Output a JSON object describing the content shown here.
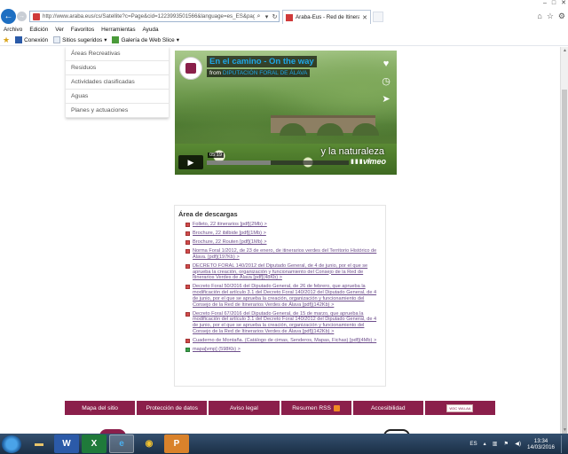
{
  "browser": {
    "address_host": "araba.eus",
    "address_url": "http://www.araba.eus/cs/Satellite?c=Page&cid=1223993501566&language=es_ES&pagename",
    "tab_label": "Araba-Eus - Red de Itinerari...",
    "menu": [
      "Archivo",
      "Edición",
      "Ver",
      "Favoritos",
      "Herramientas",
      "Ayuda"
    ],
    "favorites": [
      {
        "label": "Conexión"
      },
      {
        "label": "Sitios sugeridos"
      },
      {
        "label": "Galería de Web Slice"
      }
    ]
  },
  "sidemenu": {
    "items": [
      "Áreas Recreativas",
      "Residuos",
      "Actividades clasificadas",
      "Aguas",
      "Planes y actuaciones"
    ]
  },
  "video": {
    "title": "En el camino - On the way",
    "from_prefix": "from",
    "from_name": "DIPUTACIÓN FORAL DE ÁLAVA",
    "time": "05:19",
    "caption": "y la naturaleza",
    "brand": "vimeo",
    "progress_loaded": 0.45
  },
  "downloads": {
    "title": "Área de descargas",
    "items": [
      {
        "text": "Folleto, 22 itinerarios [pdf](2Mb) >",
        "type": "pdf"
      },
      {
        "text": "Brochure, 22 ibilbide [pdf](1Mb) >",
        "type": "pdf"
      },
      {
        "text": "Brochure, 22 Routen [pdf](1Mb) >",
        "type": "pdf"
      },
      {
        "text": "Norma Foral 1/2012, de 23 de enero, de itinerarios verdes del Territorio Histórico de Álava. [pdf](197Kb) >",
        "type": "pdf"
      },
      {
        "text": "DECRETO FORAL 140/2012 del Diputado General, de 4 de junio, por el que se aprueba la creación, organización y funcionamiento del Consejo de la Red de Itinerarios Verdes de Álava [pdf](48Kb) >",
        "type": "pdf"
      },
      {
        "text": "Decreto Foral 50/2016 del Diputado General, de 26 de febrero, que aprueba la modificación del artículo 3.1 del Decreto Foral 140/2012 del Diputado General, de 4 de junio, por el que se aprueba la creación, organización y funcionamiento del Consejo de la Red de Itinerarios Verdes de Álava [pdf](142Kb) >",
        "type": "pdf"
      },
      {
        "text": "Decreto Foral 67/2016 del Diputado General, de 15 de marzo, que aprueba la modificación del artículo 3.1 del Decreto Foral 140/2012 del Diputado General, de 4 de junio, por el que se aprueba la creación, organización y funcionamiento del Consejo de la Red de Itinerarios Verdes de Álava [pdf](142Kb) >",
        "type": "pdf"
      },
      {
        "text": "Cuaderno de Montaña. (Catálogo de cimas, Senderos, Mapas, Fichas) [pdf](4Mb) >",
        "type": "pdf"
      },
      {
        "text": "mapa[vmp] (598Kb) >",
        "type": "map"
      }
    ]
  },
  "footer": {
    "links": [
      "Mapa del sitio",
      "Protección de datos",
      "Aviso legal",
      "Resumen RSS",
      "Accesibilidad"
    ],
    "badge": "W3C WAI-AA"
  },
  "taskbar": {
    "language": "ES",
    "time": "13:34",
    "date": "14/03/2016"
  },
  "colors": {
    "brand": "#8b1f4b",
    "link": "#6e4e8c",
    "vimeo_blue": "#1ea7e8"
  }
}
